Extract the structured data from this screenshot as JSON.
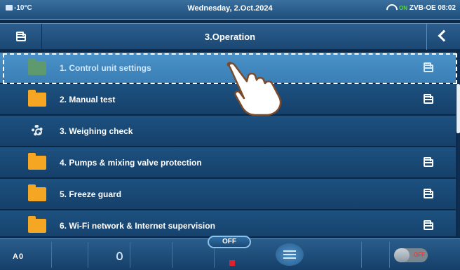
{
  "status": {
    "temperature": "-10°C",
    "date": "Wednesday, 2.Oct.2024",
    "on_label": "ON",
    "device_id": "ZVB-OE",
    "time": "08:02"
  },
  "titlebar": {
    "title": "3.Operation",
    "left_icon": "folder-outline-icon",
    "right_icon": "back-chevron-icon"
  },
  "menu": {
    "selected_index": 0,
    "items": [
      {
        "label": "1. Control unit settings",
        "icon": "folder-icon",
        "has_submenu": true
      },
      {
        "label": "2. Manual test",
        "icon": "folder-icon",
        "has_submenu": true
      },
      {
        "label": "3. Weighing check",
        "icon": "gear-icon",
        "has_submenu": false
      },
      {
        "label": "4. Pumps & mixing valve protection",
        "icon": "folder-icon",
        "has_submenu": true
      },
      {
        "label": "5. Freeze guard",
        "icon": "folder-icon",
        "has_submenu": true
      },
      {
        "label": "6. Wi-Fi network & Internet supervision",
        "icon": "folder-icon",
        "has_submenu": true
      }
    ]
  },
  "bottombar": {
    "mode_label": "A0",
    "state_label": "OFF",
    "toggle_label": "OFF"
  },
  "colors": {
    "row": "#1d5180",
    "row_selected": "#4a92c9",
    "folder": "#f5a623",
    "accent_red": "#e0202a"
  }
}
